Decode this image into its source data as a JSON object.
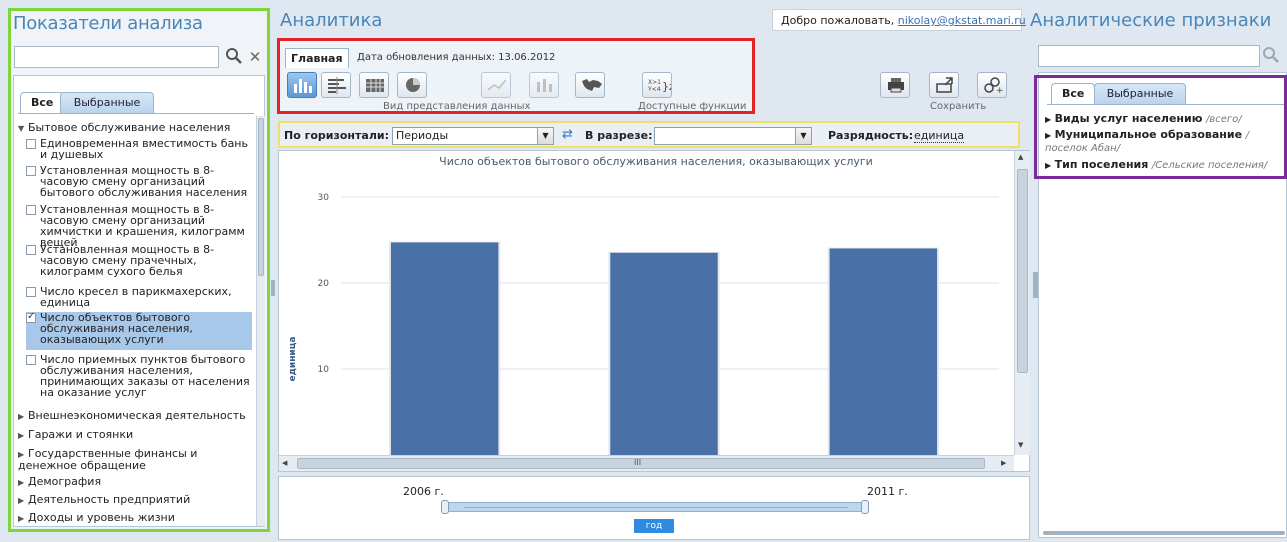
{
  "left": {
    "title": "Показатели анализа",
    "search_placeholder": "",
    "tabs": [
      "Все",
      "Выбранные"
    ],
    "groups": [
      {
        "label": "Бытовое обслуживание населения",
        "expanded": true
      },
      {
        "label": "Внешнеэкономическая деятельность"
      },
      {
        "label": "Гаражи и стоянки"
      },
      {
        "label": "Государственные финансы и денежное обращение"
      },
      {
        "label": "Демография"
      },
      {
        "label": "Деятельность предприятий"
      },
      {
        "label": "Доходы и уровень жизни"
      }
    ],
    "items": [
      {
        "label": "Единовременная вместимость бань и душевых",
        "checked": false
      },
      {
        "label": "Установленная мощность в 8-часовую смену организаций бытового обслуживания населения",
        "checked": false
      },
      {
        "label": "Установленная мощность в 8-часовую смену организаций химчистки и крашения, килограмм вещей",
        "checked": false
      },
      {
        "label": "Установленная мощность в 8-часовую смену прачечных, килограмм сухого белья",
        "checked": false
      },
      {
        "label": "Число кресел в парикмахерских, единица",
        "checked": false
      },
      {
        "label": "Число объектов бытового обслуживания населения, оказывающих услуги",
        "checked": true
      },
      {
        "label": "Число приемных пунктов бытового обслуживания населения, принимающих заказы от населения на оказание услуг",
        "checked": false
      }
    ]
  },
  "center": {
    "title": "Аналитика",
    "welcome_text": "Добро пожаловать,",
    "user_email": "nikolay@gkstat.mari.ru",
    "tab_main": "Главная",
    "update_date": "Дата обновления данных: 13.06.2012",
    "group_view": "Вид представления данных",
    "group_functions": "Доступные функции",
    "group_save": "Сохранить",
    "filter": {
      "horizontal_label": "По горизонтали:",
      "horizontal_value": "Периоды",
      "section_label": "В разрезе:",
      "section_value": "",
      "digit_label": "Разрядность:",
      "digit_value": "единица"
    },
    "slider": {
      "start": "2006 г.",
      "end": "2011 г.",
      "unit": "год"
    },
    "hscroll_mark": "III"
  },
  "chart_data": {
    "type": "bar",
    "title": "Число объектов бытового обслуживания населения, оказывающих услуги",
    "ylabel": "единица",
    "xlabel": "",
    "categories": [
      "",
      "",
      ""
    ],
    "values": [
      24.7,
      23.5,
      24.0
    ],
    "ylim": [
      0,
      33
    ],
    "yticks": [
      "10",
      "20",
      "30"
    ],
    "grid": true,
    "bar_color": "#4a70a8"
  },
  "right": {
    "title": "Аналитические признаки",
    "tabs": [
      "Все",
      "Выбранные"
    ],
    "items": [
      {
        "name": "Виды услуг населению",
        "value": "/всего/"
      },
      {
        "name": "Муниципальное образование",
        "value": "/поселок Абан/"
      },
      {
        "name": "Тип поселения",
        "value": "/Сельские поселения/"
      }
    ]
  }
}
